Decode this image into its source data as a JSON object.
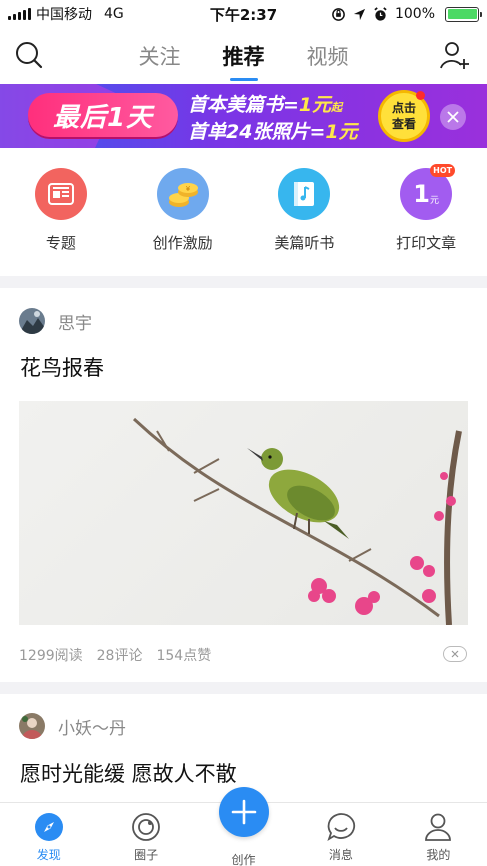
{
  "status_bar": {
    "carrier": "中国移动",
    "network": "4G",
    "time": "下午2:37",
    "battery_percent": "100%",
    "battery_level": 1.0
  },
  "top_nav": {
    "tabs": [
      {
        "label": "关注",
        "active": false
      },
      {
        "label": "推荐",
        "active": true
      },
      {
        "label": "视频",
        "active": false
      }
    ],
    "search_icon": "search-icon",
    "add_user_icon": "add-user-icon"
  },
  "banner": {
    "badge": "最后1天",
    "line1_prefix": "首本美篇书=",
    "line1_price": "1元",
    "line1_suffix": "起",
    "line2_prefix": "首单24张照片=",
    "line2_price": "1元",
    "cta_line1": "点击",
    "cta_line2": "查看",
    "colors": {
      "start": "#3a5bef",
      "end": "#9a30dc",
      "pill": "#ff2f7c",
      "cta": "#ffe03a"
    }
  },
  "shortcuts": [
    {
      "label": "专题",
      "icon": "topics-icon"
    },
    {
      "label": "创作激励",
      "icon": "coins-icon"
    },
    {
      "label": "美篇听书",
      "icon": "audio-book-icon"
    },
    {
      "label": "打印文章",
      "icon": "print-icon",
      "badge": "HOT",
      "badge_text": "1",
      "badge_unit": "元"
    }
  ],
  "feed": [
    {
      "author": "思宇",
      "title": "花鸟报春",
      "reads": "1299阅读",
      "comments": "28评论",
      "likes": "154点赞"
    },
    {
      "author": "小妖～丹",
      "title": "愿时光能缓 愿故人不散"
    }
  ],
  "bottom_bar": {
    "items": [
      {
        "label": "发现",
        "icon": "compass-icon",
        "active": true
      },
      {
        "label": "圈子",
        "icon": "circle-icon",
        "active": false
      },
      {
        "label": "创作",
        "icon": "plus-icon",
        "active": false
      },
      {
        "label": "消息",
        "icon": "chat-icon",
        "active": false
      },
      {
        "label": "我的",
        "icon": "person-icon",
        "active": false
      }
    ]
  },
  "colors": {
    "accent": "#2a8cf3"
  }
}
